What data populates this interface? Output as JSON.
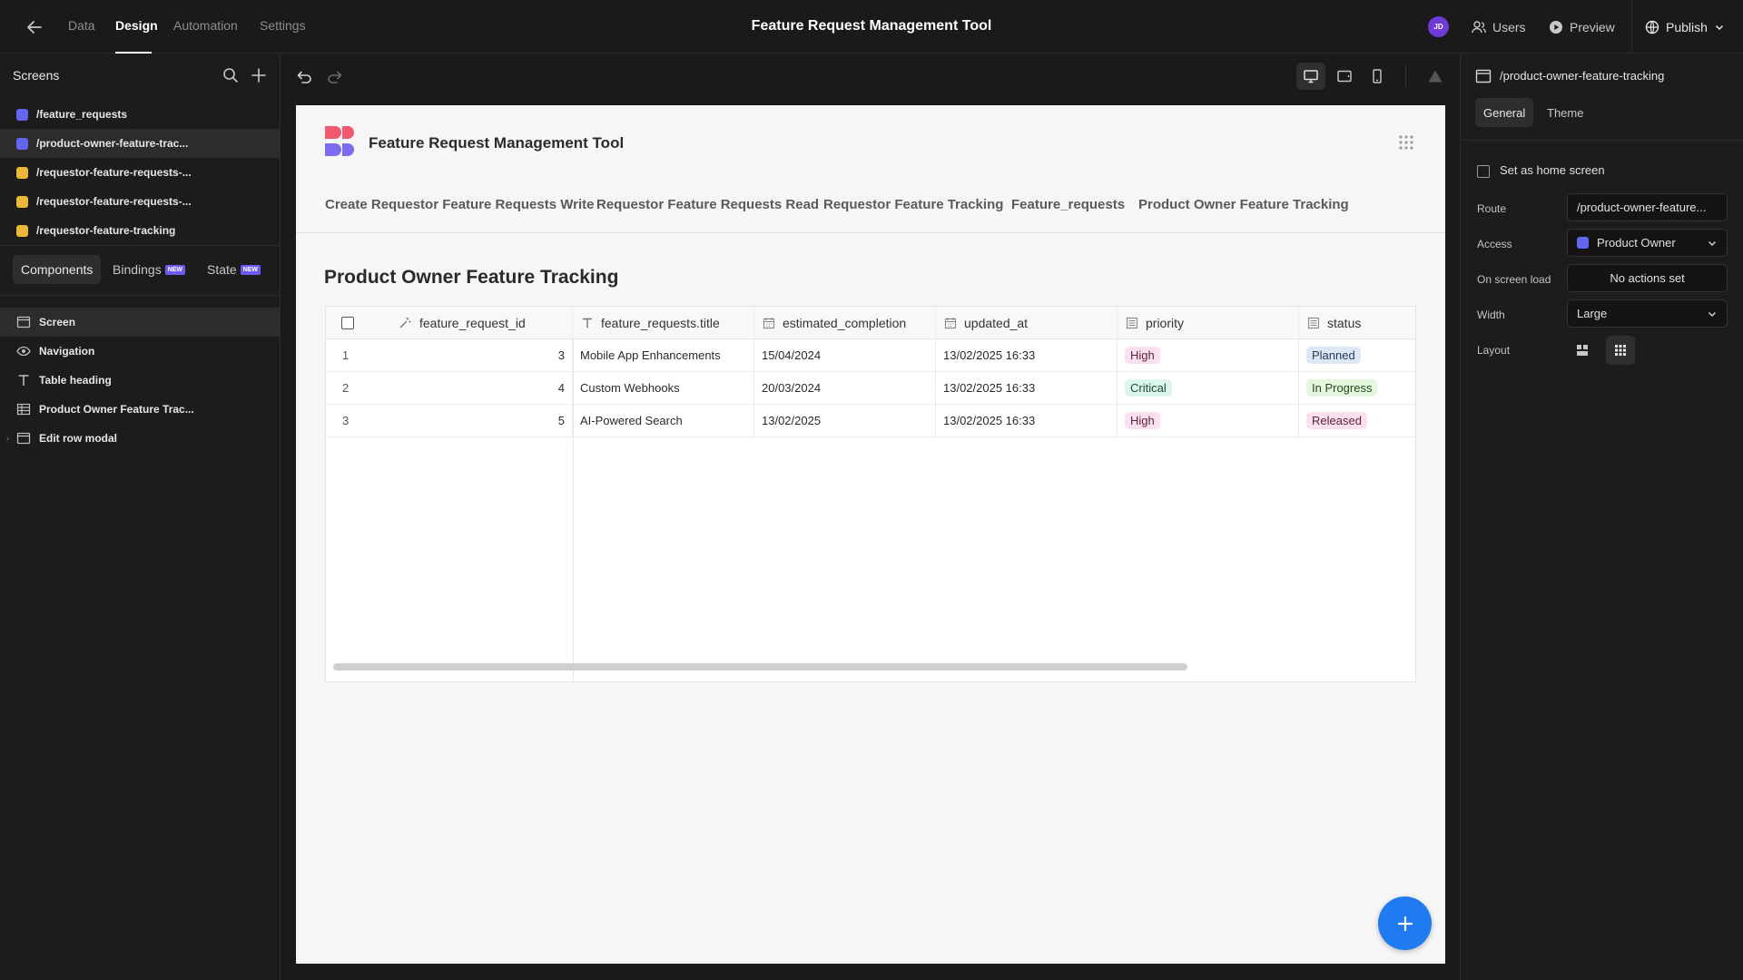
{
  "topbar": {
    "tabs": [
      {
        "label": "Data",
        "active": false
      },
      {
        "label": "Design",
        "active": true
      },
      {
        "label": "Automation",
        "active": false
      },
      {
        "label": "Settings",
        "active": false
      }
    ],
    "title": "Feature Request Management Tool",
    "avatar_initials": "JD",
    "users_label": "Users",
    "preview_label": "Preview",
    "publish_label": "Publish"
  },
  "left": {
    "screens_heading": "Screens",
    "screens": [
      {
        "label": "/feature_requests",
        "color": "#6366f1"
      },
      {
        "label": "/product-owner-feature-trac...",
        "color": "#6366f1"
      },
      {
        "label": "/requestor-feature-requests-...",
        "color": "#eab838"
      },
      {
        "label": "/requestor-feature-requests-...",
        "color": "#eab838"
      },
      {
        "label": "/requestor-feature-tracking",
        "color": "#eab838"
      }
    ],
    "tabs": [
      {
        "label": "Components",
        "active": true
      },
      {
        "label": "Bindings",
        "badge": "NEW"
      },
      {
        "label": "State",
        "badge": "NEW"
      }
    ],
    "components": [
      {
        "label": "Screen",
        "icon": "screen-icon"
      },
      {
        "label": "Navigation",
        "icon": "eye-icon"
      },
      {
        "label": "Table heading",
        "icon": "text-icon"
      },
      {
        "label": "Product Owner Feature Trac...",
        "icon": "table-icon"
      },
      {
        "label": "Edit row modal",
        "icon": "modal-icon"
      }
    ]
  },
  "app": {
    "name": "Feature Request Management Tool",
    "nav": [
      "Create Requestor Feature Requests Write",
      "Requestor Feature Requests Read",
      "Requestor Feature Tracking",
      "Feature_requests",
      "Product Owner Feature Tracking"
    ],
    "heading": "Product Owner Feature Tracking",
    "table": {
      "columns": [
        "feature_request_id",
        "feature_requests.title",
        "estimated_completion",
        "updated_at",
        "priority",
        "status"
      ],
      "rows": [
        {
          "n": "1",
          "id": "3",
          "title": "Mobile App Enhancements",
          "estimated": "15/04/2024",
          "updated": "13/02/2025 16:33",
          "priority": "High",
          "status": "Planned"
        },
        {
          "n": "2",
          "id": "4",
          "title": "Custom Webhooks",
          "estimated": "20/03/2024",
          "updated": "13/02/2025 16:33",
          "priority": "Critical",
          "status": "In Progress"
        },
        {
          "n": "3",
          "id": "5",
          "title": "AI-Powered Search",
          "estimated": "13/02/2025",
          "updated": "13/02/2025 16:33",
          "priority": "High",
          "status": "Released"
        }
      ],
      "pill_colors": {
        "High": {
          "bg": "#fbe0ef",
          "fg": "#5a2440"
        },
        "Critical": {
          "bg": "#dbf5ea",
          "fg": "#1f4a35"
        },
        "Planned": {
          "bg": "#dde8f7",
          "fg": "#233a5a"
        },
        "In Progress": {
          "bg": "#e4f6dd",
          "fg": "#2a4a20"
        },
        "Released": {
          "bg": "#fbe0ef",
          "fg": "#5a2440"
        }
      }
    }
  },
  "right": {
    "route_title": "/product-owner-feature-tracking",
    "tabs": [
      {
        "label": "General",
        "active": true
      },
      {
        "label": "Theme",
        "active": false
      }
    ],
    "home_screen_label": "Set as home screen",
    "route_label": "Route",
    "route_value": "/product-owner-feature...",
    "access_label": "Access",
    "access_value": "Product Owner",
    "access_color": "#6366f1",
    "onload_label": "On screen load",
    "onload_value": "No actions set",
    "width_label": "Width",
    "width_value": "Large",
    "layout_label": "Layout"
  }
}
